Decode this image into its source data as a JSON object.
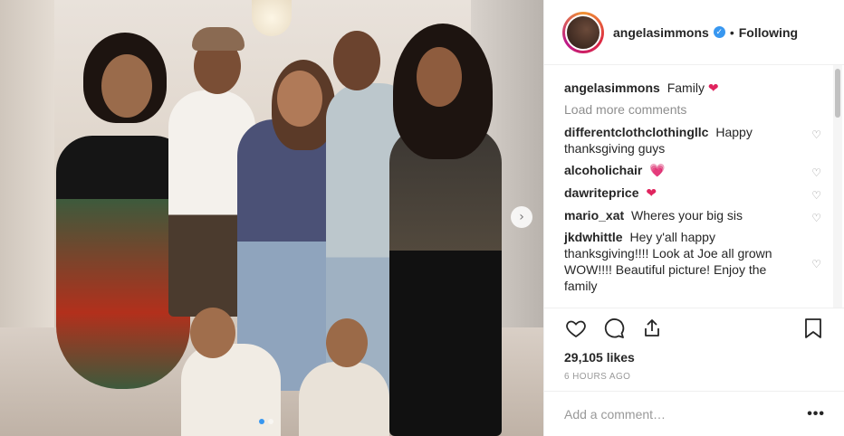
{
  "post": {
    "photo_alt": "Family photo",
    "carousel": {
      "next_icon": "chevron-right-icon",
      "next_glyph": "›",
      "dots_total": 2,
      "active_dot": 1
    }
  },
  "header": {
    "username": "angelasimmons",
    "verified_glyph": "✓",
    "separator": "•",
    "follow_status": "Following"
  },
  "caption": {
    "user": "angelasimmons",
    "text": "Family",
    "emoji": "❤"
  },
  "load_more": "Load more comments",
  "comments": [
    {
      "user": "differentclothclothingllc",
      "text": "Happy thanksgiving guys",
      "emoji": ""
    },
    {
      "user": "alcoholichair",
      "text": "",
      "emoji": "💗"
    },
    {
      "user": "dawriteprice",
      "text": "",
      "emoji": "❤"
    },
    {
      "user": "mario_xat",
      "text": "Wheres your big sis",
      "emoji": ""
    },
    {
      "user": "jkdwhittle",
      "text": "Hey y'all happy thanksgiving!!!! Look at Joe all grown WOW!!!! Beautiful picture! Enjoy the family",
      "emoji": ""
    }
  ],
  "actions": {
    "like_icon": "heart-outline-icon",
    "comment_icon": "comment-bubble-icon",
    "share_icon": "share-icon",
    "save_icon": "bookmark-icon",
    "likes": "29,105 likes",
    "timestamp": "6 HOURS AGO"
  },
  "add_comment": {
    "placeholder": "Add a comment…",
    "more_glyph": "•••"
  },
  "colors": {
    "accent": "#3897f0",
    "heart": "#e0245e",
    "text": "#262626",
    "muted": "#8e8e8e"
  }
}
